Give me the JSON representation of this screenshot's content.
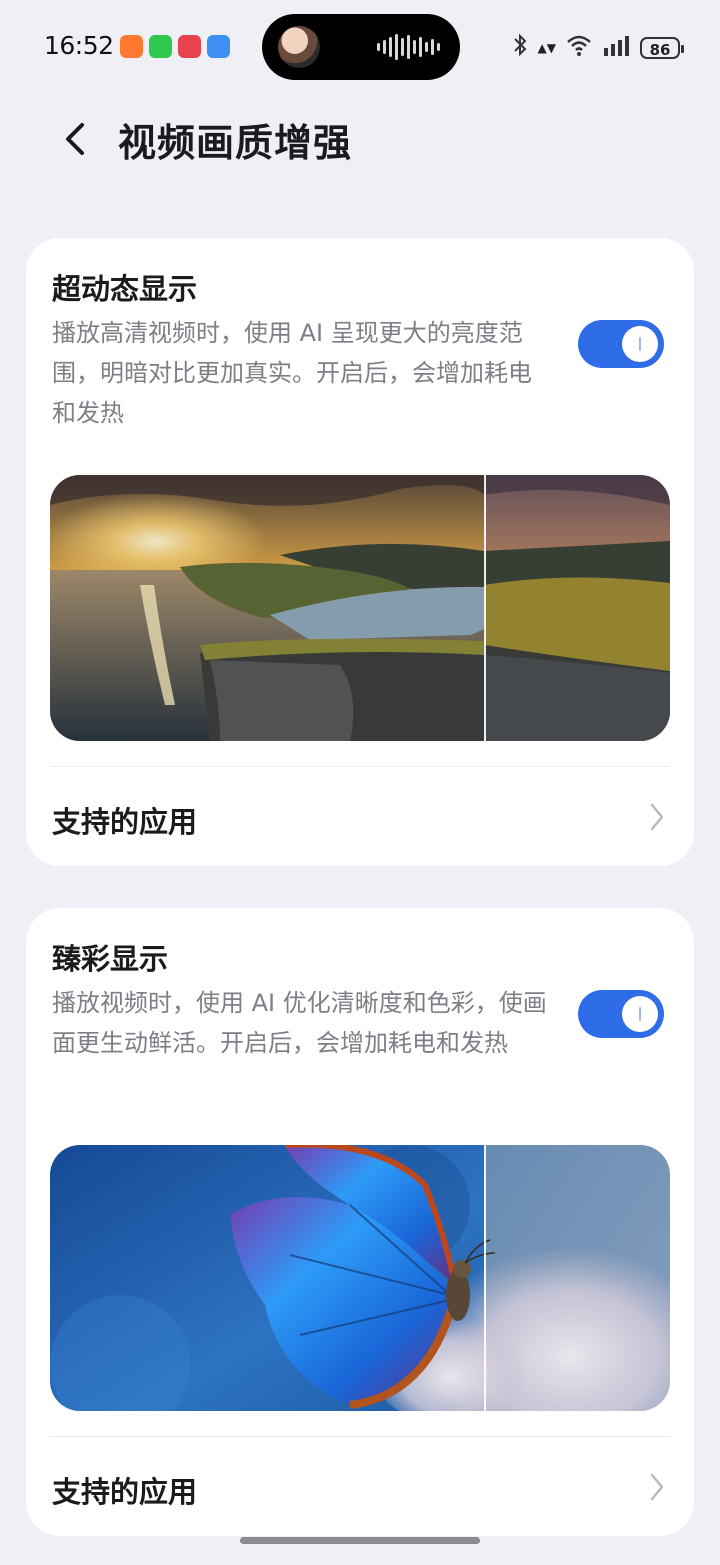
{
  "status_bar": {
    "time": "16:52",
    "battery": "86"
  },
  "header": {
    "title": "视频画质增强"
  },
  "cards": [
    {
      "title": "超动态显示",
      "description": "播放高清视频时，使用 AI 呈现更大的亮度范围，明暗对比更加真实。开启后，会增加耗电和发热",
      "toggle_on": true,
      "supported_apps_label": "支持的应用"
    },
    {
      "title": "臻彩显示",
      "description": "播放视频时，使用 AI 优化清晰度和色彩，使画面更生动鲜活。开启后，会增加耗电和发热",
      "toggle_on": true,
      "supported_apps_label": "支持的应用"
    }
  ],
  "colors": {
    "accent": "#2f6ce8",
    "background": "#eef0f5",
    "card": "#ffffff",
    "secondary_text": "#7d7f86"
  }
}
